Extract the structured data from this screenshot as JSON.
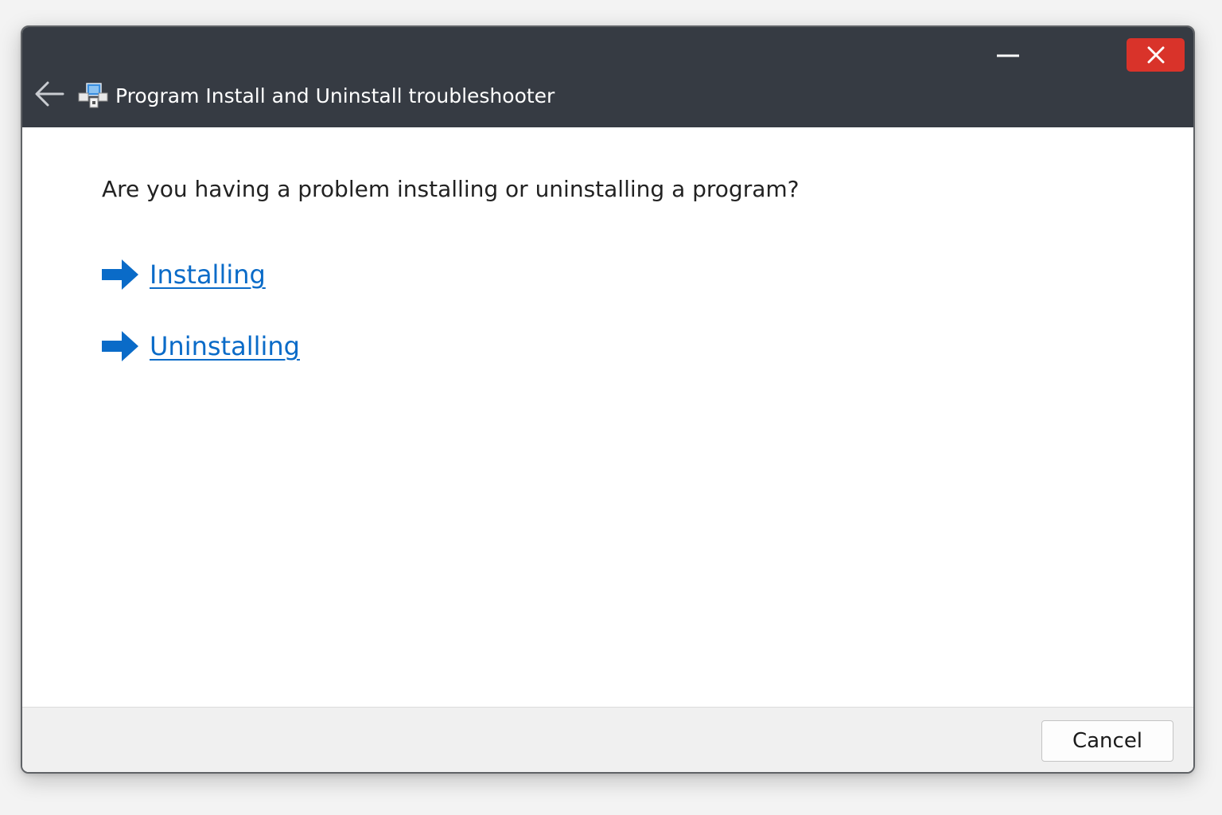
{
  "window": {
    "title": "Program Install and Uninstall troubleshooter",
    "close_glyph": "✕",
    "minimize_glyph": "—"
  },
  "icons": {
    "back": "back-arrow-icon",
    "app": "troubleshooter-app-icon",
    "minimize": "minimize-icon",
    "close": "close-icon",
    "option_arrow": "blue-right-arrow-icon"
  },
  "main": {
    "question": "Are you having a problem installing or uninstalling a program?",
    "options": [
      {
        "label": "Installing"
      },
      {
        "label": "Uninstalling"
      }
    ]
  },
  "footer": {
    "cancel_label": "Cancel"
  },
  "colors": {
    "titlebar": "#363b43",
    "close_button": "#d9332a",
    "link": "#0a6bc8",
    "arrow": "#0a6bc8",
    "footer": "#f0f0f0"
  }
}
